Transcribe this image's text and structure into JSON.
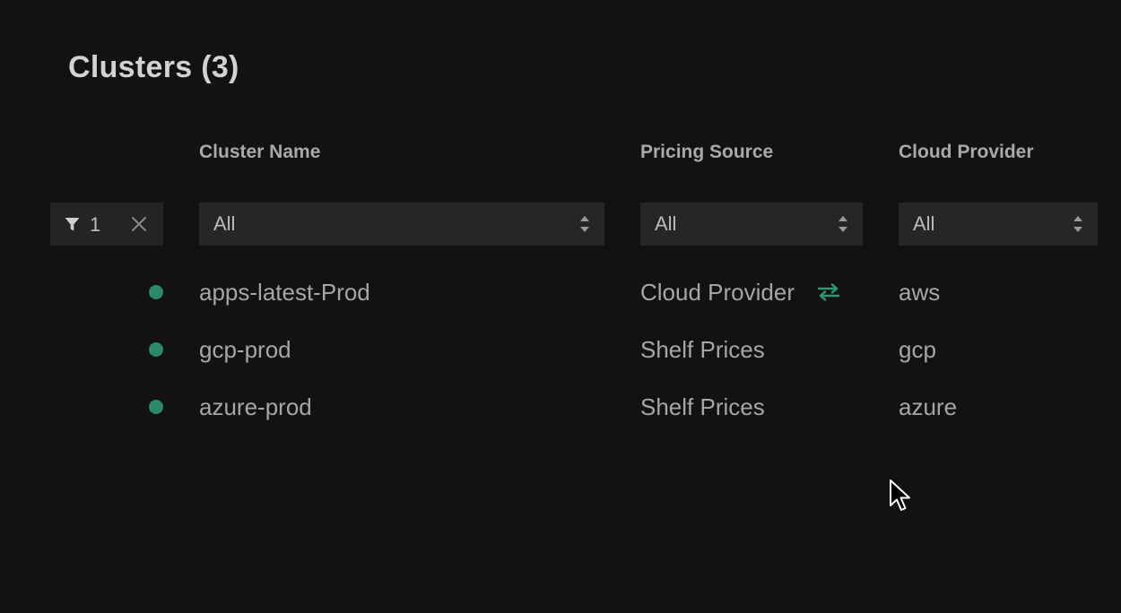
{
  "page": {
    "title": "Clusters (3)"
  },
  "columns": {
    "cluster_name": "Cluster Name",
    "pricing_source": "Pricing Source",
    "cloud_provider": "Cloud Provider"
  },
  "filters": {
    "active_count": "1",
    "cluster_name_value": "All",
    "pricing_source_value": "All",
    "cloud_provider_value": "All"
  },
  "rows": [
    {
      "name": "apps-latest-Prod",
      "pricing_source": "Cloud Provider",
      "cloud_provider": "aws",
      "status_color": "#2a8a6a",
      "has_sync_icon": true
    },
    {
      "name": "gcp-prod",
      "pricing_source": "Shelf Prices",
      "cloud_provider": "gcp",
      "status_color": "#2a8a6a",
      "has_sync_icon": false
    },
    {
      "name": "azure-prod",
      "pricing_source": "Shelf Prices",
      "cloud_provider": "azure",
      "status_color": "#2a8a6a",
      "has_sync_icon": false
    }
  ],
  "colors": {
    "background": "#121212",
    "accent": "#2a8a6a",
    "control_bg": "#262626",
    "text_primary": "#a6a6a6",
    "title": "#d2d2d2"
  },
  "icons": {
    "filter": "funnel-icon",
    "clear": "close-icon",
    "select_arrows": "sort-arrows-icon",
    "sync": "swap-arrows-icon",
    "cursor": "mouse-pointer-icon"
  }
}
